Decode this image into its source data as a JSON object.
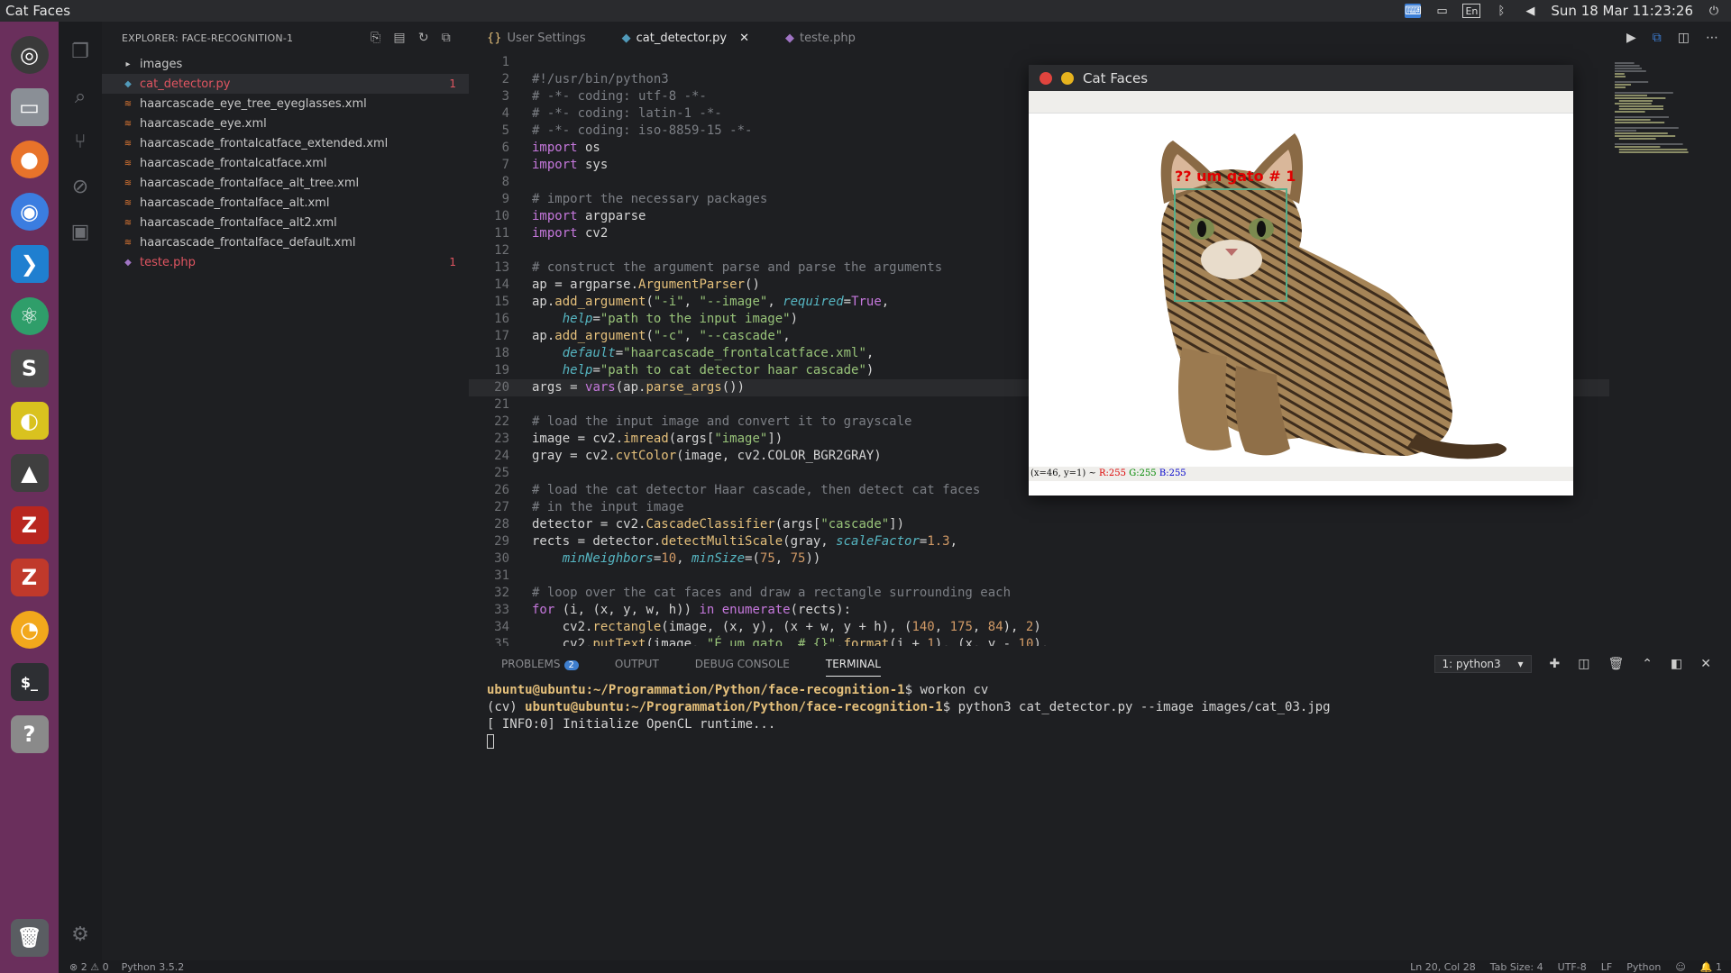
{
  "topbar": {
    "app_title": "Cat Faces",
    "datetime": "Sun 18 Mar 11:23:26",
    "lang": "En"
  },
  "launcher": [
    {
      "name": "ubuntu-dash",
      "glyph": "◎",
      "color": "#3a3a3a"
    },
    {
      "name": "files",
      "glyph": "▭",
      "color": "#8a8f96"
    },
    {
      "name": "firefox",
      "glyph": "●",
      "color": "#e8732a"
    },
    {
      "name": "chrome",
      "glyph": "◉",
      "color": "#3b7de0"
    },
    {
      "name": "vscode",
      "glyph": "❯",
      "color": "#1f7fd0"
    },
    {
      "name": "atom",
      "glyph": "⚛",
      "color": "#2f9e6a"
    },
    {
      "name": "sublime",
      "glyph": "S",
      "color": "#4a4a4a"
    },
    {
      "name": "app-yellow",
      "glyph": "◐",
      "color": "#d9c21f"
    },
    {
      "name": "inkscape",
      "glyph": "▲",
      "color": "#3f3f3f"
    },
    {
      "name": "filezilla",
      "glyph": "Z",
      "color": "#b8261f"
    },
    {
      "name": "zeal",
      "glyph": "Z",
      "color": "#c0392b"
    },
    {
      "name": "orange-app",
      "glyph": "◔",
      "color": "#f2a81c"
    },
    {
      "name": "terminal",
      "glyph": "$_",
      "color": "#2d2f33"
    },
    {
      "name": "help",
      "glyph": "?",
      "color": "#8a8a8a"
    }
  ],
  "explorer": {
    "header": "EXPLORER: FACE-RECOGNITION-1",
    "items": [
      {
        "label": "images",
        "type": "folder",
        "badge": ""
      },
      {
        "label": "cat_detector.py",
        "type": "py",
        "badge": "1",
        "selected": true
      },
      {
        "label": "haarcascade_eye_tree_eyeglasses.xml",
        "type": "xml",
        "badge": ""
      },
      {
        "label": "haarcascade_eye.xml",
        "type": "xml",
        "badge": ""
      },
      {
        "label": "haarcascade_frontalcatface_extended.xml",
        "type": "xml",
        "badge": ""
      },
      {
        "label": "haarcascade_frontalcatface.xml",
        "type": "xml",
        "badge": ""
      },
      {
        "label": "haarcascade_frontalface_alt_tree.xml",
        "type": "xml",
        "badge": ""
      },
      {
        "label": "haarcascade_frontalface_alt.xml",
        "type": "xml",
        "badge": ""
      },
      {
        "label": "haarcascade_frontalface_alt2.xml",
        "type": "xml",
        "badge": ""
      },
      {
        "label": "haarcascade_frontalface_default.xml",
        "type": "xml",
        "badge": ""
      },
      {
        "label": "teste.php",
        "type": "php",
        "badge": "1"
      }
    ]
  },
  "tabs": [
    {
      "label": "User Settings",
      "icon": "{}",
      "active": false
    },
    {
      "label": "cat_detector.py",
      "icon": "◆",
      "active": true
    },
    {
      "label": "teste.php",
      "icon": "◆",
      "active": false
    }
  ],
  "code_lines": [
    "",
    "#!/usr/bin/python3",
    "# -*- coding: utf-8 -*-",
    "# -*- coding: latin-1 -*-",
    "# -*- coding: iso-8859-15 -*-",
    "import os",
    "import sys",
    "",
    "# import the necessary packages",
    "import argparse",
    "import cv2",
    "",
    "# construct the argument parse and parse the arguments",
    "ap = argparse.ArgumentParser()",
    "ap.add_argument(\"-i\", \"--image\", required=True,",
    "    help=\"path to the input image\")",
    "ap.add_argument(\"-c\", \"--cascade\",",
    "    default=\"haarcascade_frontalcatface.xml\",",
    "    help=\"path to cat detector haar cascade\")",
    "args = vars(ap.parse_args())",
    "",
    "# load the input image and convert it to grayscale",
    "image = cv2.imread(args[\"image\"])",
    "gray = cv2.cvtColor(image, cv2.COLOR_BGR2GRAY)",
    "",
    "# load the cat detector Haar cascade, then detect cat faces",
    "# in the input image",
    "detector = cv2.CascadeClassifier(args[\"cascade\"])",
    "rects = detector.detectMultiScale(gray, scaleFactor=1.3,",
    "    minNeighbors=10, minSize=(75, 75))",
    "",
    "# loop over the cat faces and draw a rectangle surrounding each",
    "for (i, (x, y, w, h)) in enumerate(rects):",
    "    cv2.rectangle(image, (x, y), (x + w, y + h), (140, 175, 84), 2)",
    "    cv2.putText(image, \"É um gato  # {}\".format(i + 1), (x, y - 10),"
  ],
  "current_line": 20,
  "catwindow": {
    "title": "Cat Faces",
    "label": "?? um gato  # 1",
    "status_prefix": "(x=46, y=1) ~ ",
    "r": "R:255",
    "g": "G:255",
    "b": "B:255"
  },
  "panel": {
    "tabs": [
      "PROBLEMS",
      "OUTPUT",
      "DEBUG CONSOLE",
      "TERMINAL"
    ],
    "problems_count": "2",
    "terminal_select": "1: python3",
    "lines": [
      {
        "prompt": "ubuntu@ubuntu:~/Programmation/Python/face-recognition-1",
        "prefix": "",
        "cmd": "$ workon cv"
      },
      {
        "prompt": "ubuntu@ubuntu:~/Programmation/Python/face-recognition-1",
        "prefix": "(cv) ",
        "cmd": "$ python3 cat_detector.py --image images/cat_03.jpg"
      },
      {
        "prompt": "",
        "prefix": "",
        "cmd": "[ INFO:0] Initialize OpenCL runtime..."
      }
    ]
  },
  "statusbar": {
    "errors": "2",
    "warnings": "0",
    "python": "Python 3.5.2",
    "position": "Ln 20, Col 28",
    "tabsize": "Tab Size: 4",
    "encoding": "UTF-8",
    "eol": "LF",
    "language": "Python",
    "notifications": "1"
  }
}
